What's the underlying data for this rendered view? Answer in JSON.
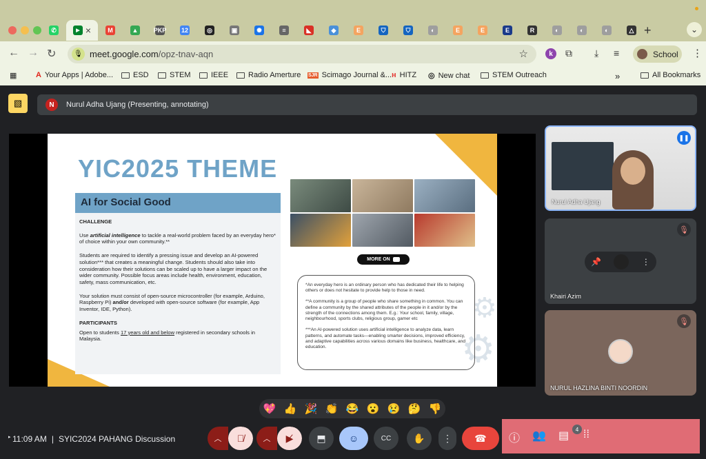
{
  "browser": {
    "tabs": [
      {
        "icon": "whatsapp-icon",
        "color": "#25d366",
        "glyph": "✆"
      },
      {
        "icon": "meet-tab-icon",
        "color": "#eff3e4",
        "glyph": "",
        "active": true
      },
      {
        "icon": "gmail-icon",
        "color": "#ea4335",
        "glyph": "M"
      },
      {
        "icon": "drive-icon",
        "color": "#34a853",
        "glyph": "▲"
      },
      {
        "icon": "pkp-icon",
        "color": "#555555",
        "glyph": "PKP"
      },
      {
        "icon": "calendar-icon",
        "color": "#4285f4",
        "glyph": "12"
      },
      {
        "icon": "chatgpt-icon",
        "color": "#222222",
        "glyph": "◎"
      },
      {
        "icon": "photo-icon",
        "color": "#777777",
        "glyph": "▣"
      },
      {
        "icon": "gear-site-icon",
        "color": "#1a73e8",
        "glyph": "✺"
      },
      {
        "icon": "site-icon",
        "color": "#666666",
        "glyph": "≡"
      },
      {
        "icon": "red-logo-icon",
        "color": "#d93025",
        "glyph": "◣"
      },
      {
        "icon": "blue-icon",
        "color": "#4a90d9",
        "glyph": "◆"
      },
      {
        "icon": "e-orange-icon",
        "color": "#f4a460",
        "glyph": "E"
      },
      {
        "icon": "shield-icon",
        "color": "#1565c0",
        "glyph": "⛉"
      },
      {
        "icon": "shield-icon-2",
        "color": "#1565c0",
        "glyph": "⛉"
      },
      {
        "icon": "grey-icon",
        "color": "#9e9e9e",
        "glyph": "◐"
      },
      {
        "icon": "e-orange-icon-2",
        "color": "#f4a460",
        "glyph": "E"
      },
      {
        "icon": "e-orange-icon-3",
        "color": "#f4a460",
        "glyph": "E"
      },
      {
        "icon": "e-blue-icon",
        "color": "#1a3a8a",
        "glyph": "E"
      },
      {
        "icon": "r-icon",
        "color": "#333333",
        "glyph": "R"
      },
      {
        "icon": "grey-icon-2",
        "color": "#9e9e9e",
        "glyph": "◐"
      },
      {
        "icon": "grey-icon-3",
        "color": "#9e9e9e",
        "glyph": "◐"
      },
      {
        "icon": "grey-icon-4",
        "color": "#9e9e9e",
        "glyph": "◐"
      },
      {
        "icon": "drive-dark-icon",
        "color": "#333333",
        "glyph": "△"
      }
    ],
    "url_host": "meet.google.com",
    "url_path": "/opz-tnav-aqn",
    "profile_label": "School",
    "extension_letter": "k",
    "bookmarks": [
      {
        "label": "Your Apps | Adobe...",
        "icon": "adobe-icon"
      },
      {
        "label": "ESD",
        "icon": "folder-icon"
      },
      {
        "label": "STEM",
        "icon": "folder-icon"
      },
      {
        "label": "IEEE",
        "icon": "folder-icon"
      },
      {
        "label": "Radio Amerture",
        "icon": "folder-icon"
      },
      {
        "label": "Scimago Journal &...",
        "icon": "sjr-icon"
      },
      {
        "label": "HITZ",
        "icon": "hitz-icon"
      },
      {
        "label": "New chat",
        "icon": "chatgpt-icon"
      },
      {
        "label": "STEM Outreach",
        "icon": "folder-icon"
      }
    ],
    "all_bookmarks": "All Bookmarks"
  },
  "meet": {
    "presenter_initial": "N",
    "presenter_banner": "Nurul Adha Ujang (Presenting, annotating)",
    "slide": {
      "title": "YIC2025 THEME",
      "band": "AI for Social Good",
      "challenge_heading": "CHALLENGE",
      "para1_pre": "Use ",
      "para1_em": "artificial intelligence",
      "para1_post": " to tackle a real-world problem faced by an everyday hero* of choice within your own community.**",
      "para2": "Students are required to identify a pressing issue and develop an AI-powered solution*** that creates a meaningful change. Students should also take into consideration how their solutions can be scaled up to have a larger impact on the wider community. Possible focus areas include health, environment, education, safety, mass communication, etc.",
      "para3_pre": "Your solution must consist of open-source microcontroller (for example, Arduino, Raspberry Pi) ",
      "para3_bold": "and/or",
      "para3_post": " developed with open-source software (for example, App Inventor, IDE, Python).",
      "participants_heading": "PARTICIPANTS",
      "participants_pre": "Open to students ",
      "participants_u": "17 years old and below",
      "participants_post": " registered in secondary schools in Malaysia.",
      "more_on": "MORE ON",
      "note1": "*An everyday hero is an ordinary person who has dedicated their life to helping others or does not hesitate to provide help to those in need.",
      "note2": "**A community is a group of people who share something in common. You can define a community by the shared attributes of the people in it and/or by the strength of the connections among them. E.g.: Your school, family, village, neighbourhood, sports clubs, religious group, gamer etc",
      "note3": "***An AI-powered solution uses artificial intelligence to analyze data, learn patterns, and automate tasks—enabling smarter decisions, improved efficiency, and adaptive capabilities across various domains like business, healthcare, and education."
    },
    "participants": [
      {
        "name": "Nurul Adha Ujang",
        "status": "speaking"
      },
      {
        "name": "Khairi Azim",
        "status": "muted"
      },
      {
        "name": "NURUL HAZLINA BINTI NOORDIN",
        "status": "muted"
      }
    ],
    "reactions": [
      "💖",
      "👍",
      "🎉",
      "👏",
      "😂",
      "😮",
      "😢",
      "🤔",
      "👎"
    ],
    "time": "11:09 AM",
    "meeting_title": "SYIC2024 PAHANG Discussion",
    "people_count": "4",
    "colors": {
      "accent_slide": "#6fa3c7",
      "slide_yellow": "#f0b63f",
      "end_call": "#e8453c",
      "panel": "#e06c75"
    }
  }
}
